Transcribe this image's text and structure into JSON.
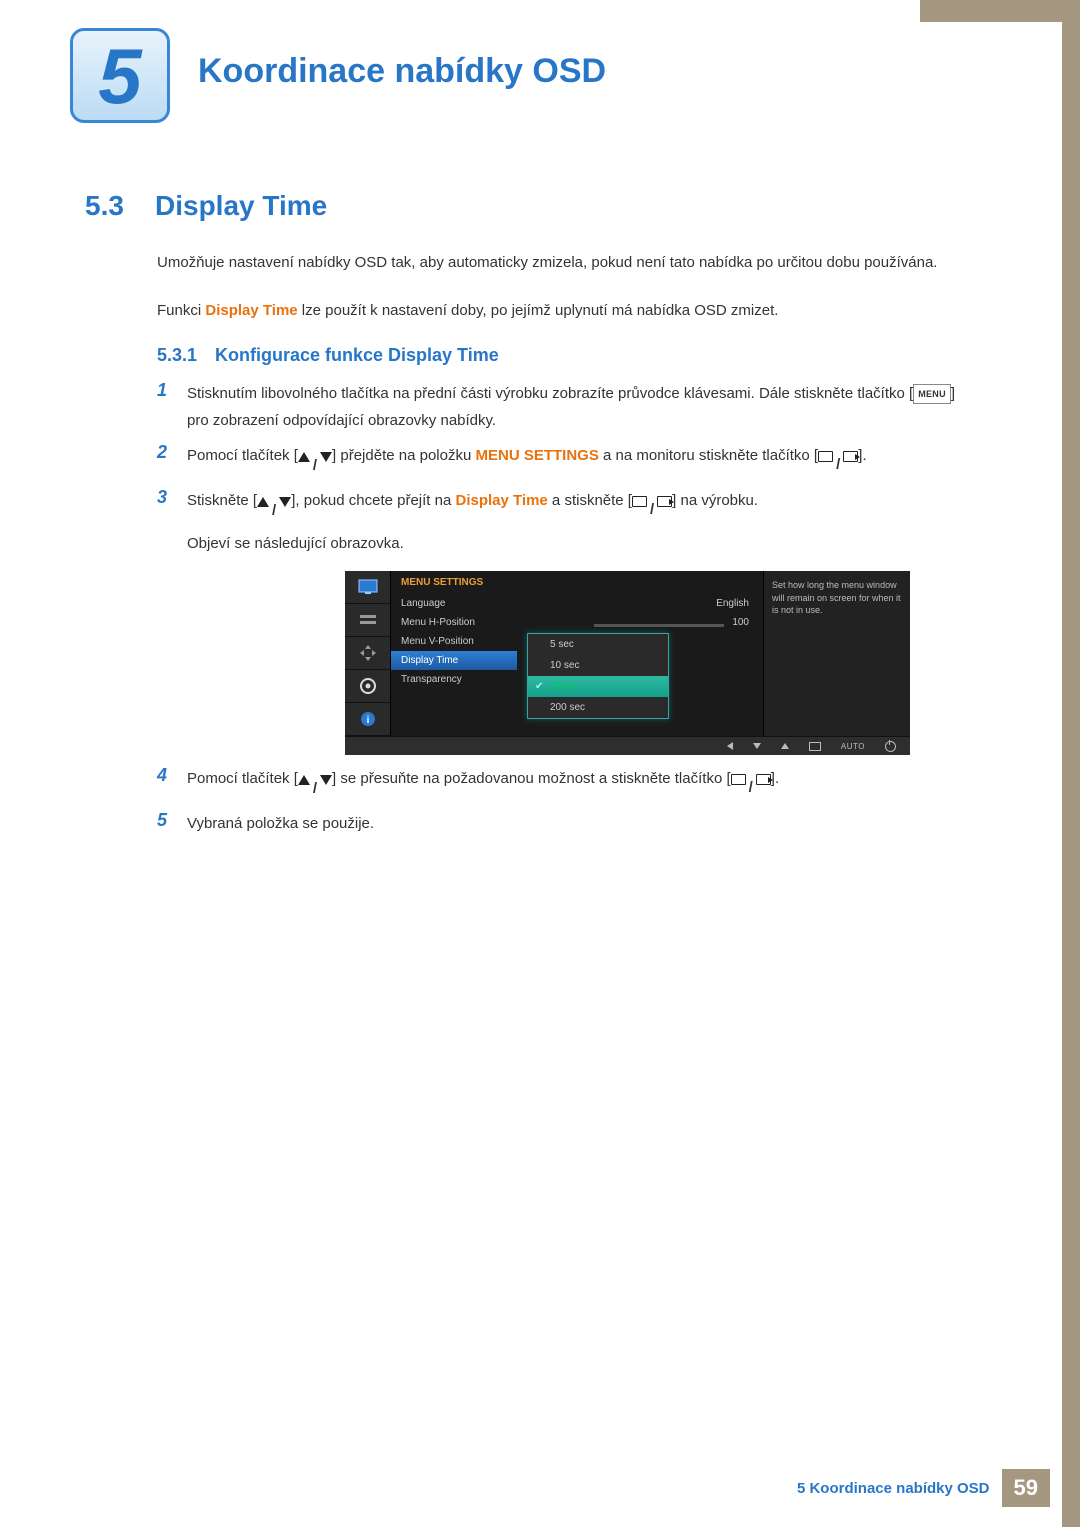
{
  "chapter": {
    "number": "5",
    "title": "Koordinace nabídky OSD"
  },
  "section": {
    "number": "5.3",
    "title": "Display Time",
    "intro1": "Umožňuje nastavení nabídky OSD tak, aby automaticky zmizela, pokud není tato nabídka po určitou dobu používána.",
    "intro2a": "Funkci ",
    "intro2b": "Display Time",
    "intro2c": " lze použít k nastavení doby, po jejímž uplynutí má nabídka OSD zmizet."
  },
  "subsection": {
    "number": "5.3.1",
    "title": "Konfigurace funkce Display Time"
  },
  "steps": {
    "1a": "Stisknutím libovolného tlačítka na přední části výrobku zobrazíte průvodce klávesami. Dále stiskněte tlačítko [",
    "1b": "] pro zobrazení odpovídající obrazovky nabídky.",
    "2a": "Pomocí tlačítek [",
    "2b": "] přejděte na položku ",
    "2c": "MENU SETTINGS",
    "2d": " a na monitoru stiskněte tlačítko [",
    "2e": "].",
    "3a": "Stiskněte [",
    "3b": "], pokud chcete přejít na ",
    "3c": "Display Time",
    "3d": " a stiskněte [",
    "3e": "] na výrobku.",
    "3f": "Objeví se následující obrazovka.",
    "4a": "Pomocí tlačítek [",
    "4b": "] se přesuňte na požadovanou možnost a stiskněte tlačítko [",
    "4c": "].",
    "5": "Vybraná položka se použije."
  },
  "menu_key": "MENU",
  "osd": {
    "header": "MENU SETTINGS",
    "rows": {
      "language": {
        "label": "Language",
        "value": "English"
      },
      "hpos": {
        "label": "Menu H-Position",
        "value": "100"
      },
      "vpos": {
        "label": "Menu V-Position"
      },
      "display_time": {
        "label": "Display Time"
      },
      "transparency": {
        "label": "Transparency"
      }
    },
    "popup": {
      "opt1": "5 sec",
      "opt2": "10 sec",
      "opt3": "20 sec",
      "opt4": "200 sec"
    },
    "help": "Set how long the menu window will remain on screen for when it is not in use.",
    "footer_auto": "AUTO"
  },
  "footer": {
    "text": "5 Koordinace nabídky OSD",
    "page": "59"
  }
}
